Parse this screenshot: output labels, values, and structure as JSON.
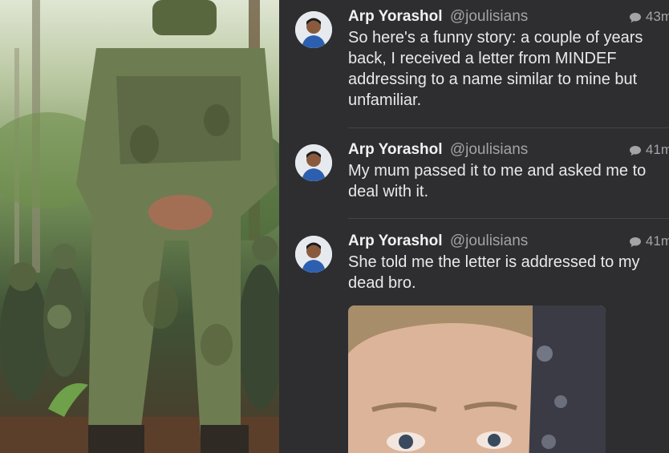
{
  "tweets": [
    {
      "name": "Arp Yorashol",
      "handle": "@joulisians",
      "time": "43m",
      "text": "So here's a funny story: a couple of years back, I received a letter from MINDEF addressing to a name similar to mine but unfamiliar."
    },
    {
      "name": "Arp Yorashol",
      "handle": "@joulisians",
      "time": "41m",
      "text": "My mum passed it to me and asked me to deal with it."
    },
    {
      "name": "Arp Yorashol",
      "handle": "@joulisians",
      "time": "41m",
      "text": "She told me the letter is addressed to my dead bro."
    }
  ],
  "icons": {
    "reply": "speech-bubble-icon",
    "avatar": "profile-avatar"
  },
  "colors": {
    "background": "#2e2e30",
    "name": "#f2f2f2",
    "handle": "#a3a3a8",
    "text": "#e9e9ea"
  }
}
